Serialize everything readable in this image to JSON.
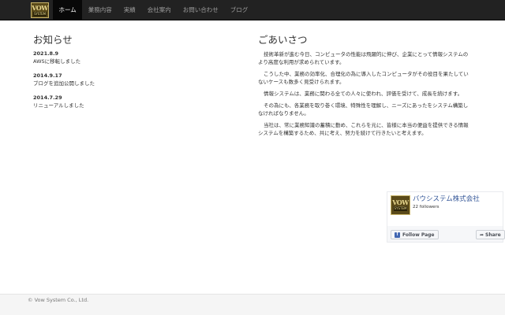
{
  "brand": {
    "logo_top": "VOW",
    "logo_bottom": "SYSTEM"
  },
  "nav": {
    "items": [
      {
        "label": "ホーム"
      },
      {
        "label": "業務内容"
      },
      {
        "label": "実績"
      },
      {
        "label": "会社案内"
      },
      {
        "label": "お問い合わせ"
      },
      {
        "label": "ブログ"
      }
    ],
    "active_index": 0
  },
  "news": {
    "heading": "お知らせ",
    "items": [
      {
        "date": "2021.8.9",
        "text": "AWSに移転しました"
      },
      {
        "date": "2014.9.17",
        "text": "ブログを追加公開しました"
      },
      {
        "date": "2014.7.29",
        "text": "リニューアルしました"
      }
    ]
  },
  "greeting": {
    "heading": "ごあいさつ",
    "paragraphs": [
      "技術革新が進む今日、コンピュータの性能は飛躍的に伸び、企業にとって情報システムのより高度な利用が求められています。",
      "こうした中、業務の効率化、合理化の為に導入したコンピュータがその役目を果たしていないケースも数多く見受けられます。",
      "情報システムは、業務に関わる全ての人々に使われ、評価を受けて、成長を続けます。",
      "その為にも、各業務を取り巻く環境、特殊性を理解し、ニーズにあったをシステム構築しなければなりません。",
      "当社は、常に業務知識の蓄積に勤め、これらを元に、皆様に本当の便益を提供できる情報システムを構築するため、共に考え、努力を続けて行きたいと考えます。"
    ]
  },
  "facebook": {
    "page_name": "バウシステム株式会社",
    "followers": "22 followers",
    "follow_label": "Follow Page",
    "share_label": "Share",
    "logo_top": "VOW",
    "logo_bottom": "SYSTEM"
  },
  "footer": {
    "copyright": "© Vow System Co., Ltd."
  },
  "colors": {
    "navbar": "#222222",
    "nav_active": "#080808",
    "link_blue": "#365899",
    "fb_blue": "#4267b2"
  }
}
